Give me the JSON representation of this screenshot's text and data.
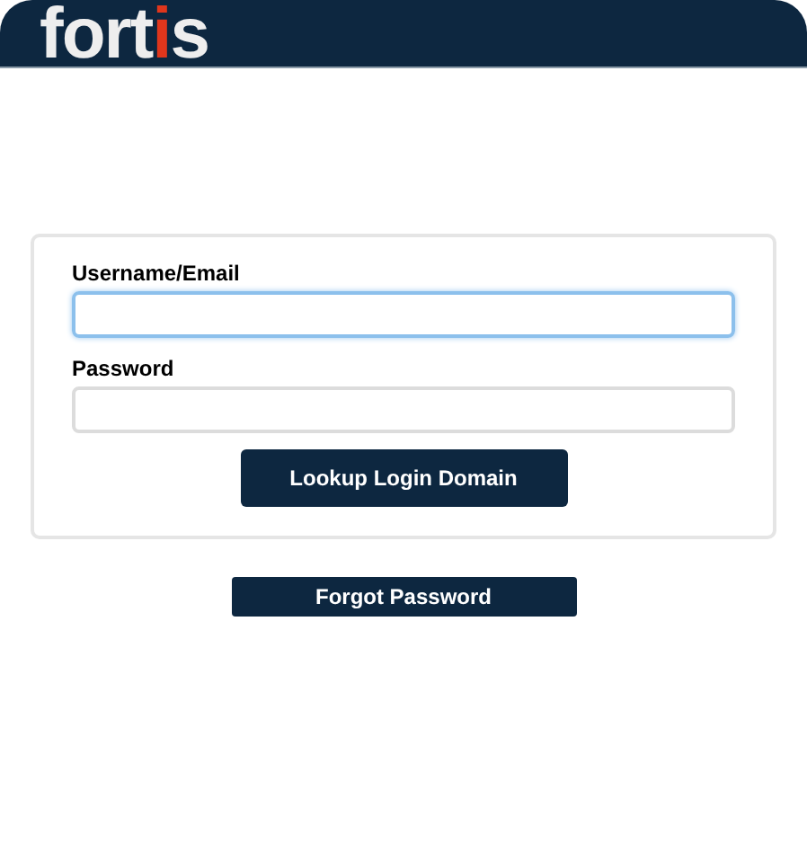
{
  "header": {
    "logo": {
      "before": "fort",
      "accent": "i",
      "after": "s"
    }
  },
  "form": {
    "fields": [
      {
        "label": "Username/Email",
        "focused": true
      },
      {
        "label": "Password",
        "focused": false
      }
    ],
    "submit": "Lookup Login Domain"
  },
  "forgot": "Forgot Password"
}
